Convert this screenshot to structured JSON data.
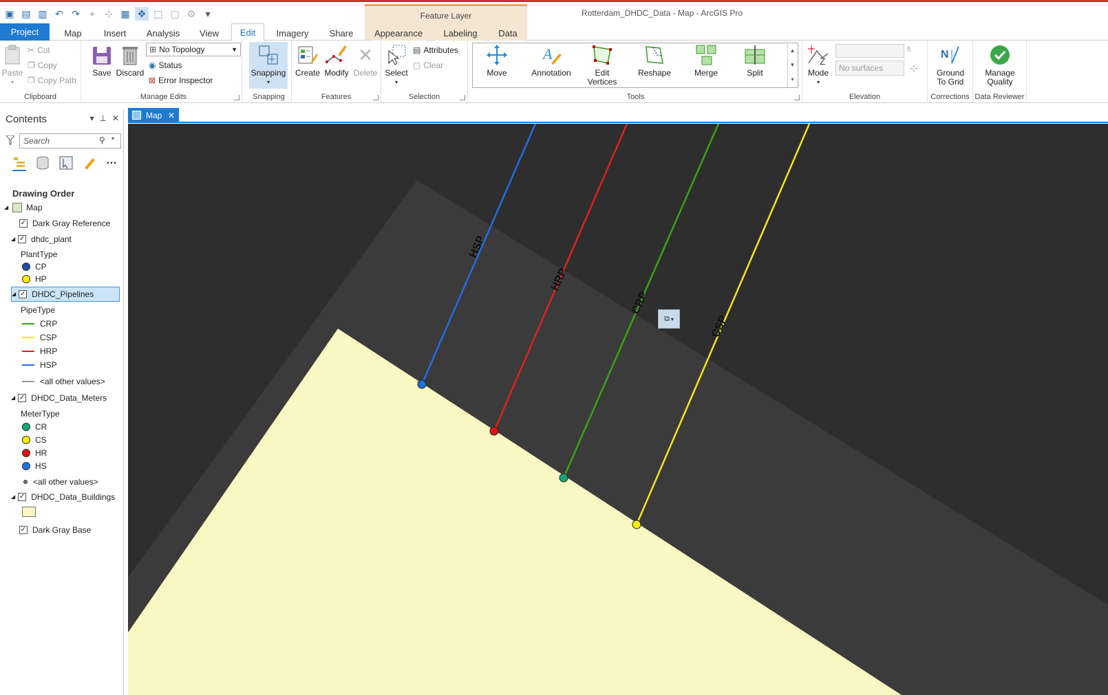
{
  "window": {
    "title": "Rotterdam_DHDC_Data - Map - ArcGIS Pro",
    "context_band": "Feature Layer"
  },
  "tabs": [
    "Project",
    "Map",
    "Insert",
    "Analysis",
    "View",
    "Edit",
    "Imagery",
    "Share",
    "Appearance",
    "Labeling",
    "Data"
  ],
  "ribbon": {
    "clipboard": {
      "paste": "Paste",
      "cut": "Cut",
      "copy": "Copy",
      "copy_path": "Copy Path",
      "label": "Clipboard"
    },
    "manage_edits": {
      "save": "Save",
      "discard": "Discard",
      "topology": "No Topology",
      "status": "Status",
      "error_inspector": "Error Inspector",
      "label": "Manage Edits"
    },
    "snapping": {
      "snapping": "Snapping",
      "label": "Snapping"
    },
    "features": {
      "create": "Create",
      "modify": "Modify",
      "delete": "Delete",
      "label": "Features"
    },
    "selection": {
      "select": "Select",
      "attributes": "Attributes",
      "clear": "Clear",
      "label": "Selection"
    },
    "tools": {
      "move": "Move",
      "annotation": "Annotation",
      "edit_vertices_1": "Edit",
      "edit_vertices_2": "Vertices",
      "reshape": "Reshape",
      "merge": "Merge",
      "split": "Split",
      "label": "Tools"
    },
    "elevation": {
      "mode": "Mode",
      "ft": "ft",
      "surfaces": "No surfaces",
      "label": "Elevation"
    },
    "corrections": {
      "ground_1": "Ground",
      "ground_2": "To Grid",
      "label": "Corrections"
    },
    "data_reviewer": {
      "manage_1": "Manage",
      "manage_2": "Quality",
      "label": "Data Reviewer"
    }
  },
  "contents": {
    "title": "Contents",
    "search_placeholder": "Search",
    "drawing_order": "Drawing Order",
    "map": "Map",
    "dark_gray_reference": "Dark Gray Reference",
    "dhdc_plant": "dhdc_plant",
    "plant_type": "PlantType",
    "plant_items": [
      {
        "label": "CP",
        "color": "#1f4fa0"
      },
      {
        "label": "HP",
        "color": "#ffee00"
      }
    ],
    "pipelines": "DHDC_Pipelines",
    "pipe_type": "PipeType",
    "pipe_items": [
      {
        "label": "CRP",
        "color": "#3aa314"
      },
      {
        "label": "CSP",
        "color": "#f5e61a"
      },
      {
        "label": "HRP",
        "color": "#e02020"
      },
      {
        "label": "HSP",
        "color": "#1f6fe0"
      },
      {
        "label": "<all other values>",
        "color": "#9a9a9a"
      }
    ],
    "meters": "DHDC_Data_Meters",
    "meter_type": "MeterType",
    "meter_items": [
      {
        "label": "CR",
        "color": "#17a37a"
      },
      {
        "label": "CS",
        "color": "#ffee00"
      },
      {
        "label": "HR",
        "color": "#e01010"
      },
      {
        "label": "HS",
        "color": "#1f6fe0"
      },
      {
        "label": "<all other values>",
        "color": "#777777"
      }
    ],
    "buildings": "DHDC_Data_Buildings",
    "building_fill": "#fbf7c3",
    "dark_gray_base": "Dark Gray Base"
  },
  "map_tab": {
    "label": "Map"
  },
  "map": {
    "pipe_labels": [
      "HSP",
      "HRP",
      "CRP",
      "CSP"
    ],
    "colors": {
      "background": "#2e2e2e",
      "band": "#3b3b3b",
      "building": "#fbf7c3"
    }
  }
}
